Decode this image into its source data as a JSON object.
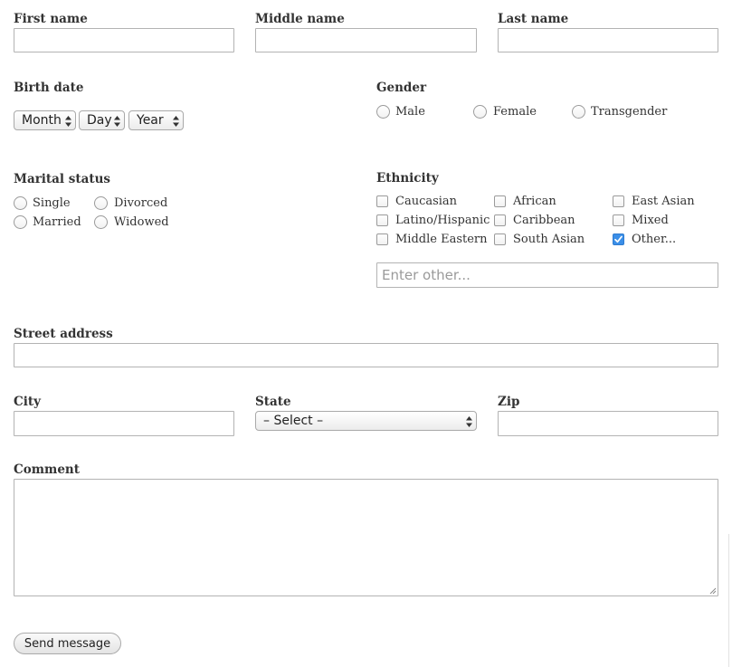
{
  "name": {
    "first_label": "First name",
    "middle_label": "Middle name",
    "last_label": "Last name"
  },
  "birth": {
    "label": "Birth date",
    "month": "Month",
    "day": "Day",
    "year": "Year"
  },
  "gender": {
    "label": "Gender",
    "options": [
      "Male",
      "Female",
      "Transgender"
    ]
  },
  "marital": {
    "label": "Marital status",
    "options": [
      "Single",
      "Divorced",
      "Married",
      "Widowed"
    ]
  },
  "ethnicity": {
    "label": "Ethnicity",
    "options": [
      "Caucasian",
      "African",
      "East Asian",
      "Latino/Hispanic",
      "Caribbean",
      "Mixed",
      "Middle Eastern",
      "South Asian",
      "Other..."
    ],
    "checked": "Other...",
    "other_placeholder": "Enter other..."
  },
  "address": {
    "street_label": "Street address",
    "city_label": "City",
    "state_label": "State",
    "state_value": "– Select –",
    "zip_label": "Zip"
  },
  "comment": {
    "label": "Comment"
  },
  "submit": {
    "label": "Send message"
  },
  "colors": {
    "checkbox_checked": "#3b8fe8"
  }
}
